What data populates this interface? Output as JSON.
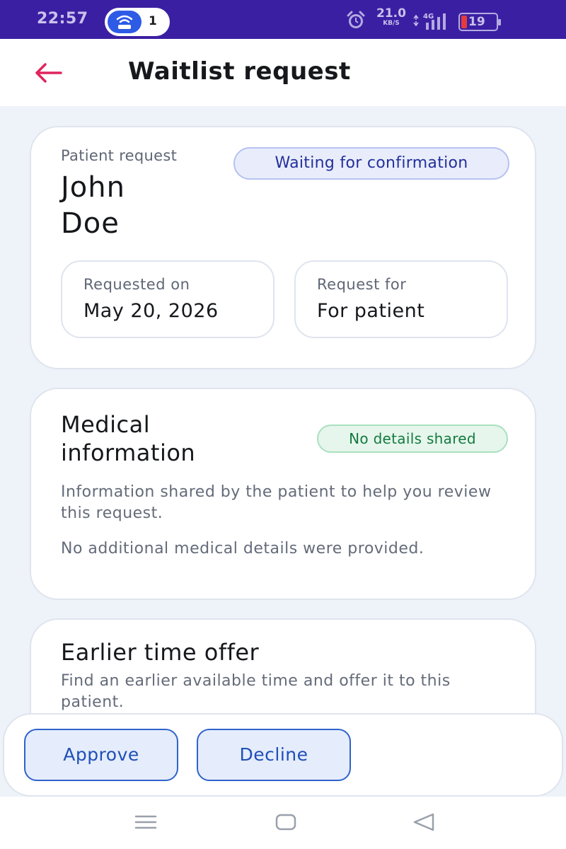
{
  "status_bar": {
    "time": "22:57",
    "hotspot_count": "1",
    "speed_value": "21.0",
    "speed_unit": "KB/S",
    "network": "4G",
    "battery_level": "19",
    "icons": [
      "wifi-hotspot-icon",
      "alarm-icon",
      "signal-icon",
      "battery-icon"
    ],
    "colors": {
      "background": "#3b1fa3",
      "battery_low": "#e43b3b"
    }
  },
  "header": {
    "back_icon": "arrow-left-icon",
    "title": "Waitlist request",
    "accent_color": "#e0245e"
  },
  "request_card": {
    "label": "Patient request",
    "patient_name_first": "John",
    "patient_name_last": "Doe",
    "status_badge": "Waiting for confirmation",
    "requested_on_label": "Requested on",
    "requested_on_value": "May 20, 2026",
    "request_for_label": "Request for",
    "request_for_value": "For patient"
  },
  "medical_card": {
    "heading_line1": "Medical",
    "heading_line2": "information",
    "badge": "No details shared",
    "description": "Information shared by the patient to help you review this request.",
    "empty_text": "No additional medical details were provided."
  },
  "offer_card": {
    "heading": "Earlier time offer",
    "description": "Find an earlier available time and offer it to this patient."
  },
  "actions": {
    "approve_label": "Approve",
    "decline_label": "Decline",
    "button_color": "#2f63cc"
  },
  "nav_bar": {
    "icons": [
      "menu-icon",
      "home-icon",
      "back-triangle-icon"
    ]
  }
}
